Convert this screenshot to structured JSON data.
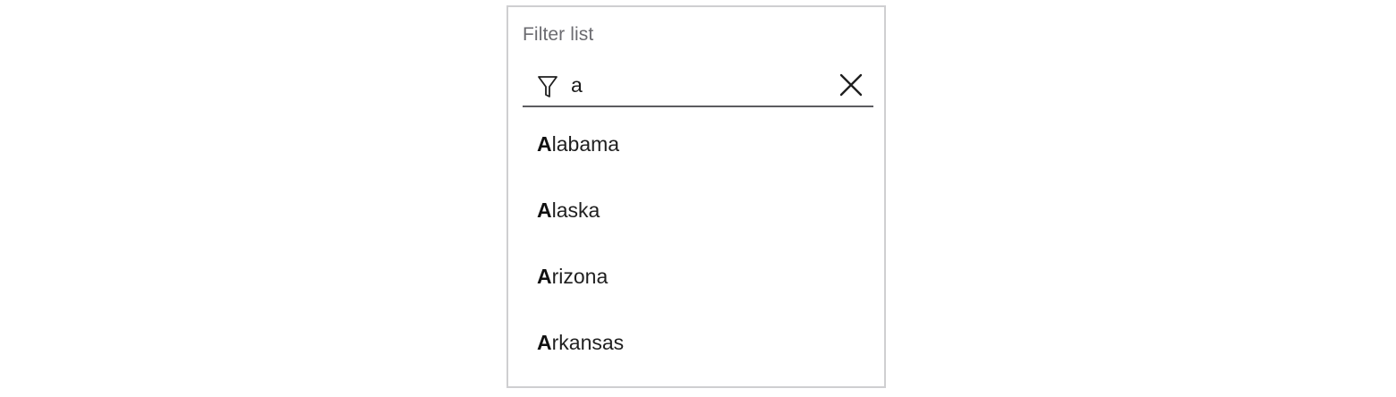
{
  "filter": {
    "label": "Filter list",
    "value": "a",
    "icon": "filter-icon",
    "clear_icon": "close-icon"
  },
  "results": [
    {
      "match": "A",
      "rest": "labama"
    },
    {
      "match": "A",
      "rest": "laska"
    },
    {
      "match": "A",
      "rest": "rizona"
    },
    {
      "match": "A",
      "rest": "rkansas"
    }
  ],
  "colors": {
    "border": "#cfcfd1",
    "label": "#6b6b70",
    "underline": "#5c5c60",
    "text": "#1f1f1f"
  }
}
